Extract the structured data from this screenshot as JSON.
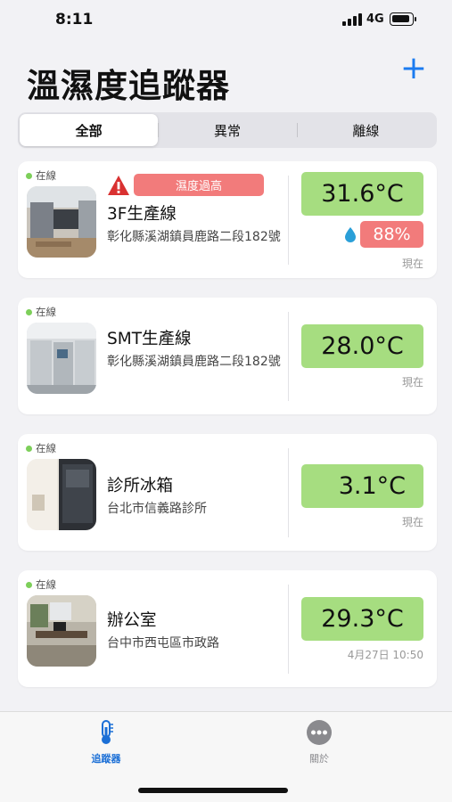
{
  "status_bar": {
    "time": "8:11",
    "network": "4G"
  },
  "header": {
    "title": "溫濕度追蹤器",
    "add_label": "+"
  },
  "filter_tabs": [
    {
      "label": "全部",
      "selected": true
    },
    {
      "label": "異常",
      "selected": false
    },
    {
      "label": "離線",
      "selected": false
    }
  ],
  "devices": [
    {
      "status": "在線",
      "name": "3F生產線",
      "address": "彰化縣溪湖鎮員鹿路二段182號",
      "alert": "濕度過高",
      "temperature": "31.6°C",
      "humidity": "88%",
      "updated": "現在"
    },
    {
      "status": "在線",
      "name": "SMT生產線",
      "address": "彰化縣溪湖鎮員鹿路二段182號",
      "temperature": "28.0°C",
      "updated": "現在"
    },
    {
      "status": "在線",
      "name": "診所冰箱",
      "address": "台北市信義路診所",
      "temperature": "3.1°C",
      "updated": "現在"
    },
    {
      "status": "在線",
      "name": "辦公室",
      "address": "台中市西屯區市政路",
      "temperature": "29.3°C",
      "updated": "4月27日 10:50"
    }
  ],
  "tab_bar": [
    {
      "label": "追蹤器",
      "icon": "thermometer-icon",
      "active": true
    },
    {
      "label": "關於",
      "icon": "more-icon",
      "active": false
    }
  ],
  "colors": {
    "accent": "#1b7bf0",
    "temp_ok": "#a6dd80",
    "alert": "#f27b7b",
    "online": "#7dcf5a"
  }
}
